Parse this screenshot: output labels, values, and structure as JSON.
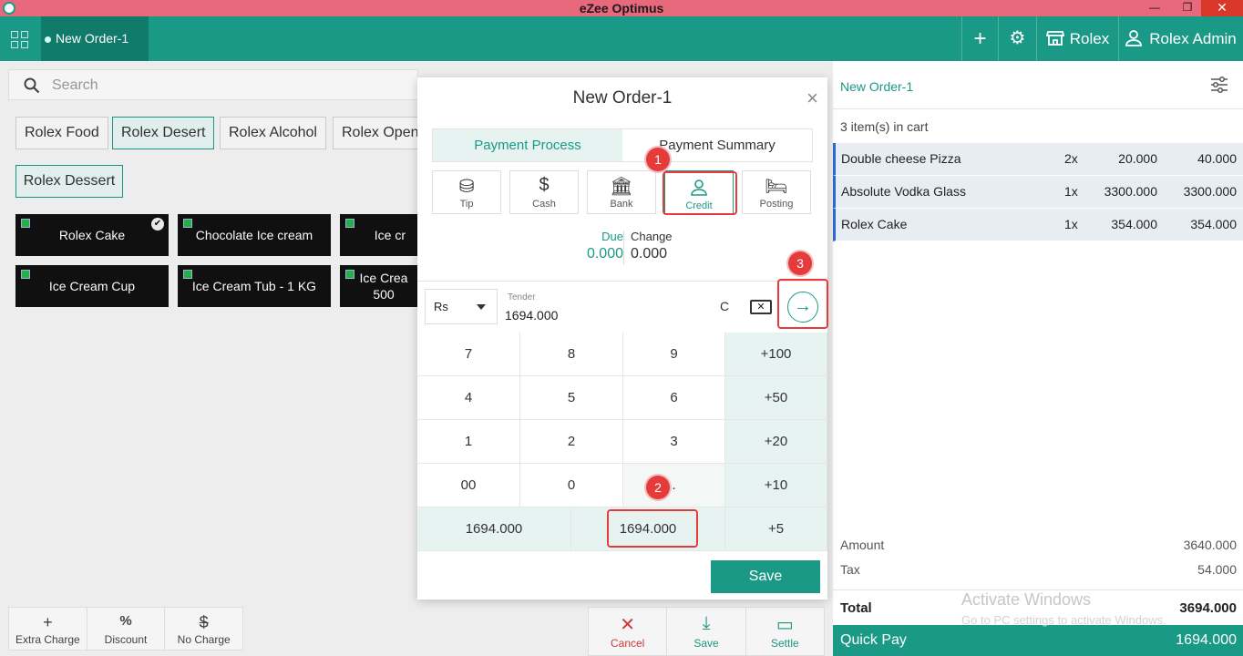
{
  "window": {
    "title": "eZee Optimus",
    "minimize": "—",
    "maximize": "❐",
    "close": "✕"
  },
  "topnav": {
    "order_tab": "New Order-1",
    "add": "+",
    "settings_icon": "⚙",
    "outlet": "Rolex",
    "user": "Rolex Admin"
  },
  "search": {
    "placeholder": "Search"
  },
  "categories": [
    "Rolex Food",
    "Rolex Desert",
    "Rolex Alcohol",
    "Rolex Open"
  ],
  "subcategory": "Rolex Dessert",
  "items": [
    "Rolex Cake",
    "Chocolate Ice cream",
    "Ice cr",
    "Ice Cream Cup",
    "Ice Cream Tub - 1 KG",
    "Ice Crea 500"
  ],
  "tools": {
    "extra": "Extra Charge",
    "discount": "Discount",
    "nocharge": "No Charge"
  },
  "actions": {
    "cancel": "Cancel",
    "save": "Save",
    "settle": "Settle"
  },
  "cart": {
    "title": "New Order-1",
    "count": "3 item(s) in cart",
    "rows": [
      {
        "name": "Double cheese Pizza",
        "qty": "2x",
        "price": "20.000",
        "total": "40.000"
      },
      {
        "name": "Absolute Vodka Glass",
        "qty": "1x",
        "price": "3300.000",
        "total": "3300.000"
      },
      {
        "name": "Rolex Cake",
        "qty": "1x",
        "price": "354.000",
        "total": "354.000"
      }
    ],
    "amount_label": "Amount",
    "amount": "3640.000",
    "tax_label": "Tax",
    "tax": "54.000",
    "total_label": "Total",
    "total": "3694.000",
    "quickpay_label": "Quick Pay",
    "quickpay": "1694.000"
  },
  "watermark": {
    "line1": "Activate Windows",
    "line2": "Go to PC settings to activate Windows."
  },
  "modal": {
    "title": "New Order-1",
    "close": "×",
    "tabs": [
      "Payment Process",
      "Payment Summary"
    ],
    "methods": [
      "Tip",
      "Cash",
      "Bank",
      "Credit",
      "Posting"
    ],
    "due_label": "Due",
    "due": "0.000",
    "change_label": "Change",
    "change": "0.000",
    "currency": "Rs",
    "tender_label": "Tender",
    "tender": "1694.000",
    "clear": "C",
    "keys": [
      "7",
      "8",
      "9",
      "+100",
      "4",
      "5",
      "6",
      "+50",
      "1",
      "2",
      "3",
      "+20",
      "00",
      "0",
      ".",
      "+10"
    ],
    "quick1": "1694.000",
    "quick2": "1694.000",
    "plus5": "+5",
    "save": "Save"
  },
  "markers": [
    "1",
    "2",
    "3"
  ]
}
